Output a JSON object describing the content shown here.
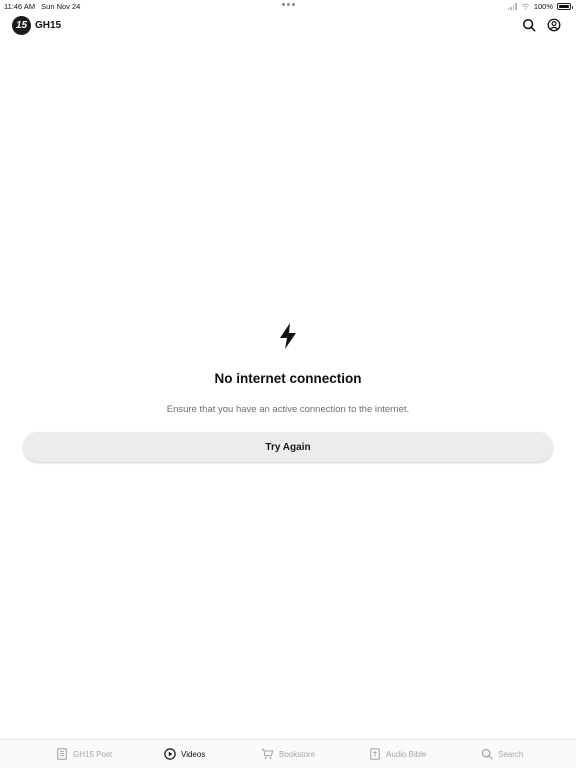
{
  "status_bar": {
    "time": "11:46 AM",
    "date": "Sun Nov 24",
    "battery": "100%"
  },
  "header": {
    "logo_text": "15",
    "title": "GH15",
    "icons": [
      "search-icon",
      "user-icon"
    ]
  },
  "empty_state": {
    "icon": "lightning-bolt-icon",
    "title": "No internet connection",
    "message": "Ensure that you have an active connection to the internet.",
    "retry_label": "Try Again"
  },
  "tab_bar": {
    "active": "Videos",
    "tabs": [
      {
        "label": "GH15 Post",
        "icon": "newspaper-icon"
      },
      {
        "label": "Videos",
        "icon": "play-circle-icon"
      },
      {
        "label": "Bookstore",
        "icon": "cart-icon"
      },
      {
        "label": "Audio Bible",
        "icon": "bible-icon"
      },
      {
        "label": "Search",
        "icon": "search-icon"
      }
    ]
  },
  "colors": {
    "active_tab": "#111111",
    "inactive_tab": "#a6a6a6",
    "button_bg": "#ececee",
    "message_text": "#6e6e6e"
  }
}
